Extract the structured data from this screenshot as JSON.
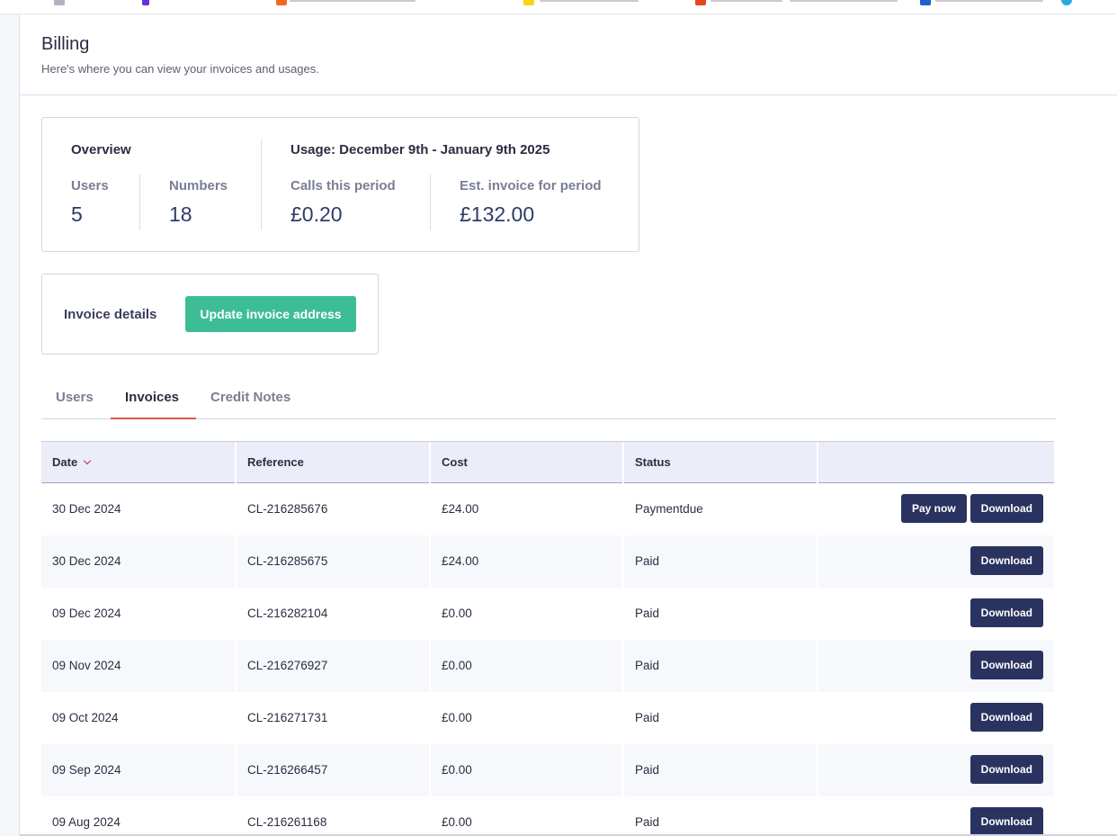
{
  "page": {
    "title": "Billing",
    "subtitle": "Here's where you can view your invoices and usages."
  },
  "overview": {
    "heading": "Overview",
    "users_label": "Users",
    "users_value": "5",
    "numbers_label": "Numbers",
    "numbers_value": "18",
    "usage_heading": "Usage: December 9th - January 9th 2025",
    "calls_label": "Calls this period",
    "calls_value": "£0.20",
    "est_label": "Est. invoice for period",
    "est_value": "£132.00"
  },
  "invoice_details": {
    "label": "Invoice details",
    "button_label": "Update invoice address",
    "button_color": "#3dbd96"
  },
  "tabs": [
    {
      "label": "Users",
      "active": false
    },
    {
      "label": "Invoices",
      "active": true
    },
    {
      "label": "Credit Notes",
      "active": false
    }
  ],
  "table": {
    "columns": [
      "Date",
      "Reference",
      "Cost",
      "Status",
      ""
    ],
    "sorted_column": "Date",
    "rows": [
      {
        "date": "30 Dec 2024",
        "reference": "CL-216285676",
        "cost": "£24.00",
        "status": "Paymentdue",
        "pay_label": "Pay now",
        "download_label": "Download"
      },
      {
        "date": "30 Dec 2024",
        "reference": "CL-216285675",
        "cost": "£24.00",
        "status": "Paid",
        "download_label": "Download"
      },
      {
        "date": "09 Dec 2024",
        "reference": "CL-216282104",
        "cost": "£0.00",
        "status": "Paid",
        "download_label": "Download"
      },
      {
        "date": "09 Nov 2024",
        "reference": "CL-216276927",
        "cost": "£0.00",
        "status": "Paid",
        "download_label": "Download"
      },
      {
        "date": "09 Oct 2024",
        "reference": "CL-216271731",
        "cost": "£0.00",
        "status": "Paid",
        "download_label": "Download"
      },
      {
        "date": "09 Sep 2024",
        "reference": "CL-216266457",
        "cost": "£0.00",
        "status": "Paid",
        "download_label": "Download"
      },
      {
        "date": "09 Aug 2024",
        "reference": "CL-216261168",
        "cost": "£0.00",
        "status": "Paid",
        "download_label": "Download"
      }
    ]
  },
  "colors": {
    "accent_dark": "#2a3360",
    "tab_underline": "#e0534f",
    "sort_chevron": "#c4246b",
    "header_bg": "#ebedf8"
  },
  "icons": {
    "sort": "chevron-down-icon"
  }
}
